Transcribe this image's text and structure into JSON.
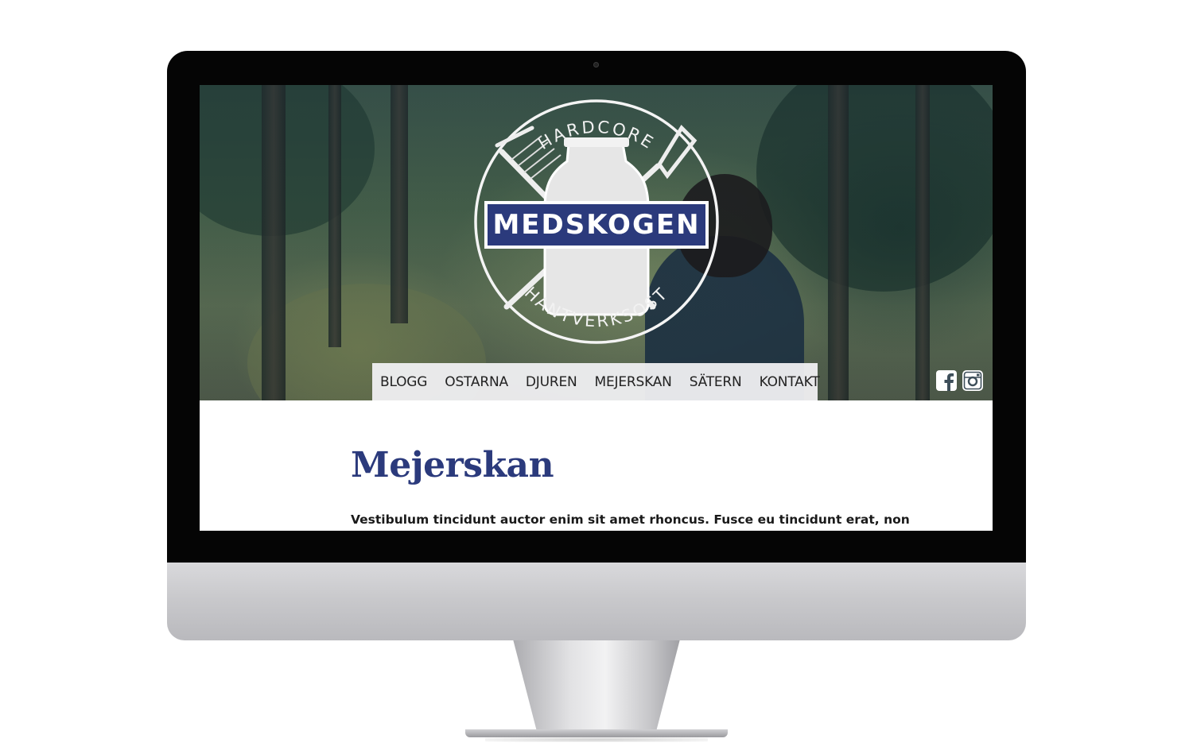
{
  "brand": {
    "name": "MEDSKOGEN",
    "arc_top": "HARDCORE",
    "arc_bottom": "HANTVERKSOST",
    "primary_color": "#2b3a7c"
  },
  "nav": {
    "items": [
      {
        "label": "BLOGG"
      },
      {
        "label": "OSTARNA"
      },
      {
        "label": "DJUREN"
      },
      {
        "label": "MEJERSKAN"
      },
      {
        "label": "SÄTERN"
      },
      {
        "label": "KONTAKT"
      }
    ]
  },
  "social": {
    "icons": [
      "facebook-icon",
      "instagram-icon"
    ]
  },
  "content": {
    "title": "Mejerskan",
    "paragraph": "Vestibulum tincidunt auctor enim sit amet rhoncus. Fusce eu tincidunt erat, non"
  }
}
